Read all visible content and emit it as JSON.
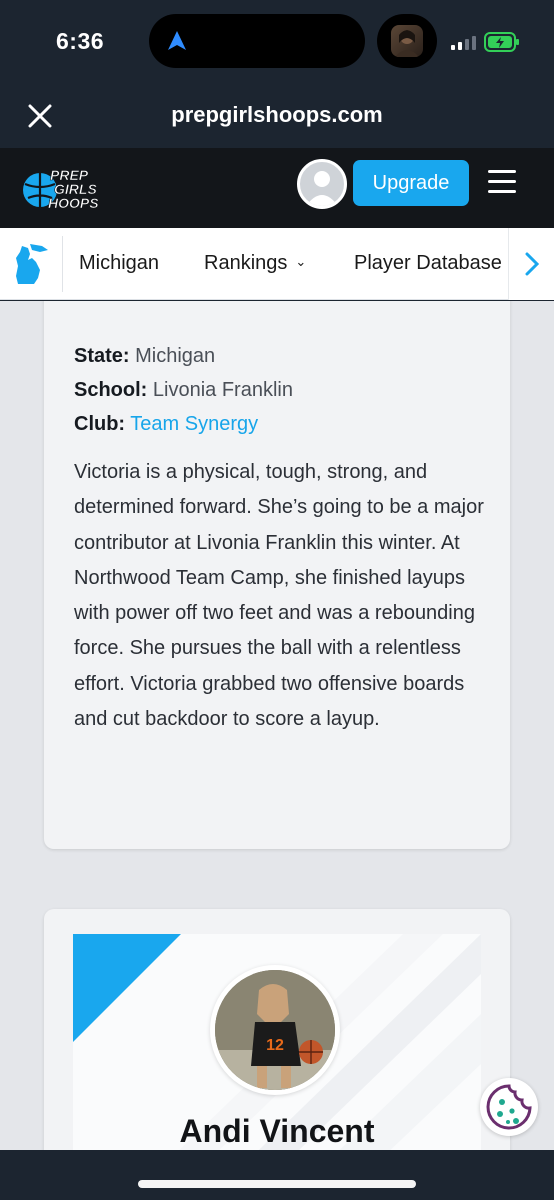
{
  "status_bar": {
    "time": "6:36",
    "navigation_icon": "location-arrow-icon",
    "signal_icon": "cellular-signal-icon",
    "battery_icon": "battery-charging-icon"
  },
  "browser": {
    "close_icon": "close-icon",
    "url": "prepgirlshoops.com"
  },
  "header": {
    "logo_lines": [
      "PREP",
      "GIRLS",
      "HOOPS"
    ],
    "avatar_icon": "user-avatar-icon",
    "upgrade_label": "Upgrade",
    "menu_icon": "hamburger-menu-icon",
    "accent_color": "#19a7ee"
  },
  "subnav": {
    "state_icon": "michigan-state-icon",
    "items": [
      {
        "label": "Michigan"
      },
      {
        "label": "Rankings"
      },
      {
        "label": "Player Database"
      }
    ],
    "scroll_icon": "chevron-right-icon"
  },
  "profile": {
    "state_label": "State:",
    "state_value": "Michigan",
    "school_label": "School:",
    "school_value": "Livonia Franklin",
    "club_label": "Club:",
    "club_value": "Team Synergy",
    "bio": "Victoria is a physical, tough, strong, and determined forward. She’s going to be a major contributor at Livonia Franklin this winter. At Northwood Team Camp, she finished layups with power off two feet and was a rebounding force. She pursues the ball with a relentless effort. Victoria grabbed two offensive boards and cut backdoor to score a layup."
  },
  "next_player": {
    "name": "Andi Vincent",
    "jersey_number": "12"
  },
  "cookie_icon": "cookie-icon"
}
